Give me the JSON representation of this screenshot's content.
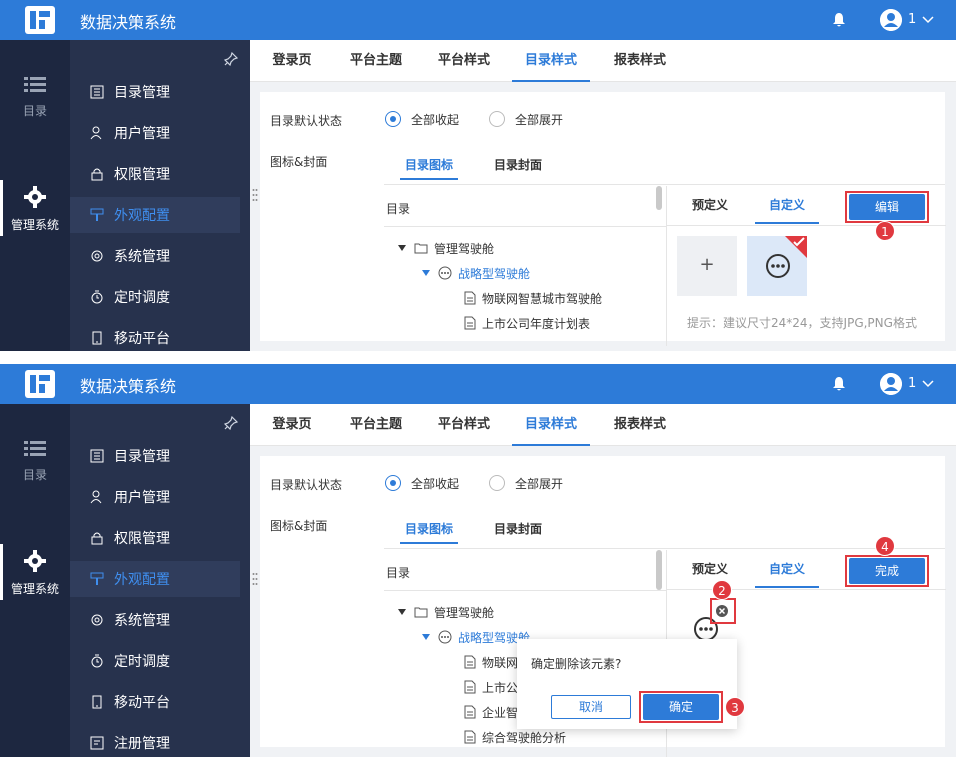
{
  "app": {
    "title": "数据决策系统",
    "user": "1"
  },
  "iconbar": {
    "catalog": "目录",
    "admin": "管理系统"
  },
  "menu": {
    "items": [
      "目录管理",
      "用户管理",
      "权限管理",
      "外观配置",
      "系统管理",
      "定时调度",
      "移动平台",
      "注册管理"
    ],
    "active_index": 3
  },
  "tabs": [
    "登录页",
    "平台主题",
    "平台样式",
    "目录样式",
    "报表样式"
  ],
  "active_tab_index": 3,
  "form": {
    "default_state_label": "目录默认状态",
    "radio_collapse": "全部收起",
    "radio_expand": "全部展开",
    "icon_cover_label": "图标&封面"
  },
  "subtabs": [
    "目录图标",
    "目录封面"
  ],
  "tree": {
    "header": "目录",
    "root": "管理驾驶舱",
    "group": "战略型驾驶舱",
    "panel1_leaves": [
      "物联网智慧城市驾驶舱",
      "上市公司年度计划表"
    ],
    "panel2_leaves": [
      "物联网",
      "上市公",
      "企业智",
      "综合驾驶舱分析"
    ]
  },
  "icon_tabs": {
    "predefined": "预定义",
    "custom": "自定义"
  },
  "buttons": {
    "edit": "编辑",
    "done": "完成"
  },
  "tiles": {
    "add": "+"
  },
  "hint": "提示：建议尺寸24*24，支持JPG,PNG格式",
  "dialog": {
    "message": "确定删除该元素?",
    "cancel": "取消",
    "confirm": "确定"
  },
  "badges": [
    "1",
    "2",
    "3",
    "4"
  ],
  "colors": {
    "topbar": "#2d7bd8",
    "sidebar": "#1d2740",
    "menu": "#27324d",
    "accent": "#2d7bd8",
    "highlight": "#e0393f"
  }
}
